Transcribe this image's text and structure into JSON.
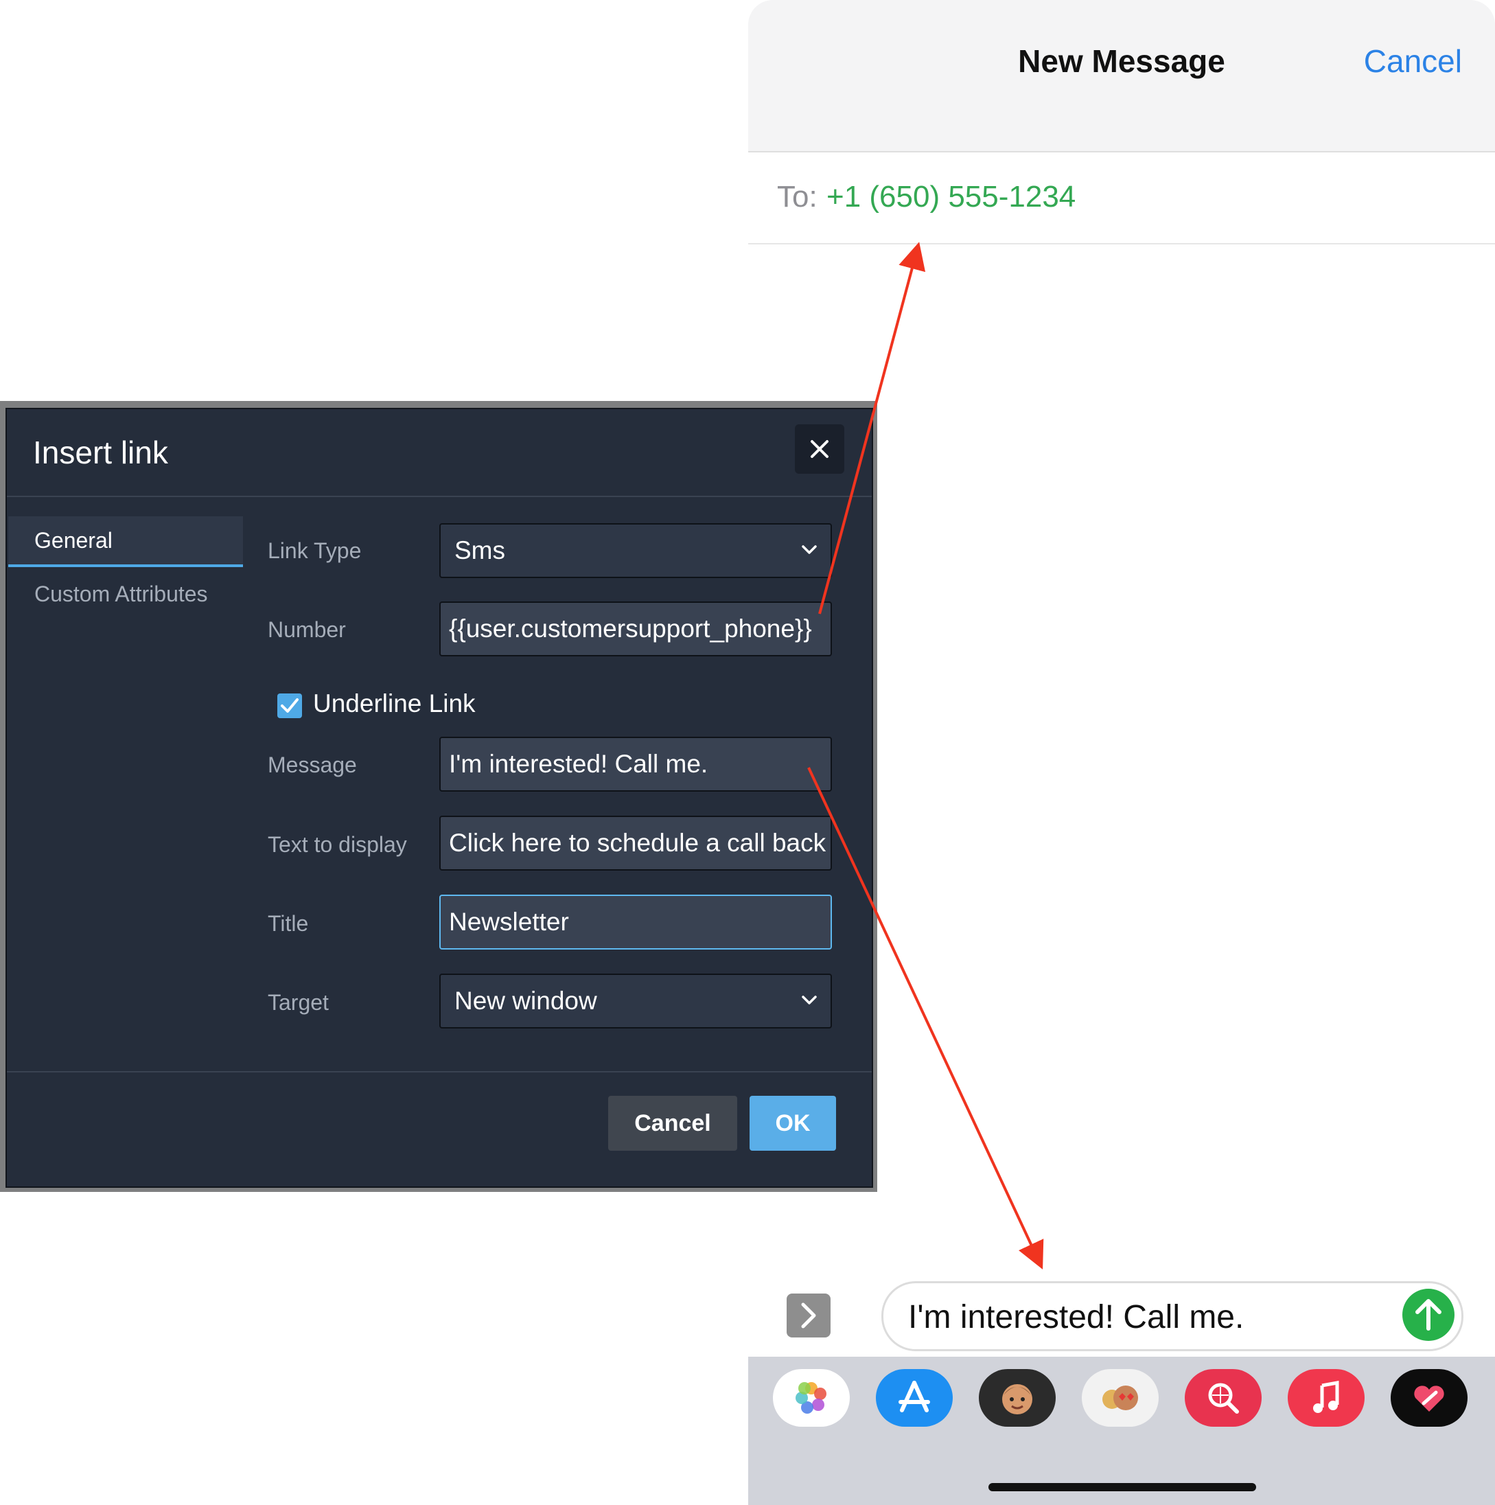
{
  "phone": {
    "title": "New Message",
    "cancel_label": "Cancel",
    "to_label": "To:",
    "to_number": "+1 (650) 555-1234",
    "message_text": "I'm interested! Call me.",
    "app_icons": [
      "photos-icon",
      "app-store-icon",
      "memoji-icon",
      "animoji-stickers-icon",
      "image-search-icon",
      "music-icon",
      "digital-touch-icon"
    ]
  },
  "dialog": {
    "title": "Insert link",
    "tabs": [
      {
        "label": "General",
        "active": true
      },
      {
        "label": "Custom Attributes",
        "active": false
      }
    ],
    "fields": {
      "link_type": {
        "label": "Link Type",
        "value": "Sms"
      },
      "number": {
        "label": "Number",
        "value": "{{user.customersupport_phone}}"
      },
      "underline": {
        "label": "Underline Link",
        "checked": true
      },
      "message": {
        "label": "Message",
        "value": "I'm interested! Call me."
      },
      "text_to_display": {
        "label": "Text to display",
        "value": "Click here to schedule a call back"
      },
      "title": {
        "label": "Title",
        "value": "Newsletter"
      },
      "target": {
        "label": "Target",
        "value": "New window"
      }
    },
    "cancel_label": "Cancel",
    "ok_label": "OK"
  },
  "colors": {
    "dialog_bg": "#252d3b",
    "accent": "#4fa9e6",
    "arrow": "#f0341f",
    "ios_blue": "#2b82e6",
    "ios_green": "#34a853"
  }
}
